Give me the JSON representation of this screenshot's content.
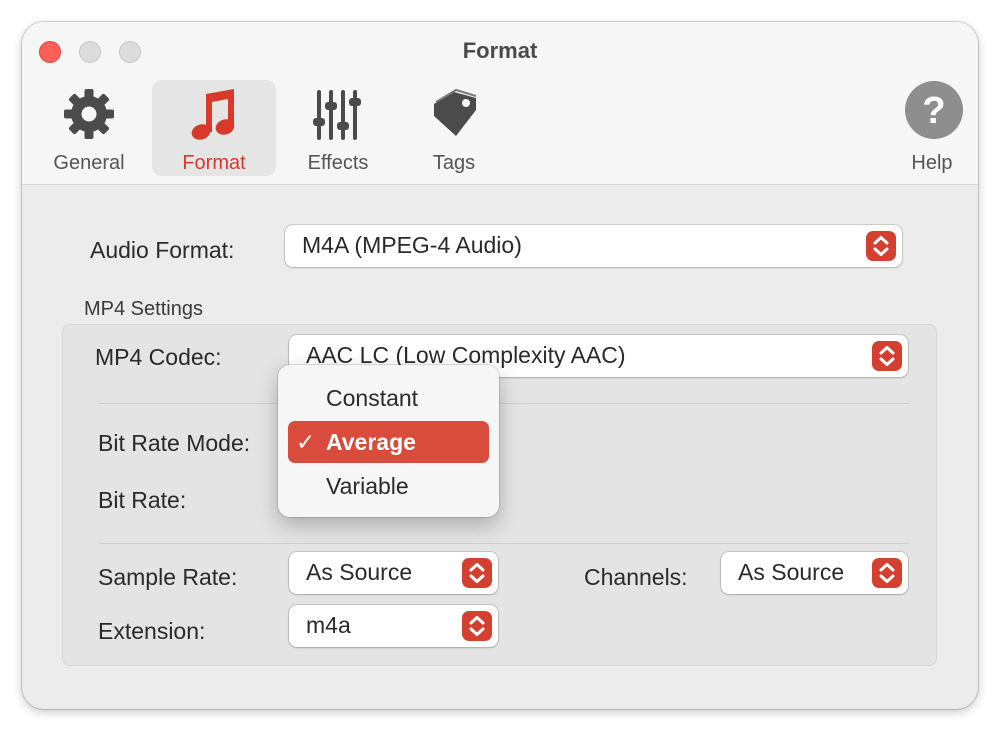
{
  "window": {
    "title": "Format"
  },
  "toolbar": {
    "general": {
      "label": "General",
      "icon": "gear-icon"
    },
    "format": {
      "label": "Format",
      "icon": "music-note-icon"
    },
    "effects": {
      "label": "Effects",
      "icon": "sliders-icon"
    },
    "tags": {
      "label": "Tags",
      "icon": "tag-icon"
    },
    "help": {
      "label": "Help",
      "icon": "question-icon"
    },
    "selected": "format"
  },
  "form": {
    "audio_format": {
      "label": "Audio Format:",
      "value": "M4A (MPEG-4 Audio)"
    },
    "mp4_settings": {
      "title": "MP4 Settings",
      "codec": {
        "label": "MP4 Codec:",
        "value": "AAC LC (Low Complexity AAC)"
      },
      "bit_rate_mode": {
        "label": "Bit Rate Mode:"
      },
      "bit_rate": {
        "label": "Bit Rate:"
      },
      "sample_rate": {
        "label": "Sample Rate:",
        "value": "As Source"
      },
      "channels": {
        "label": "Channels:",
        "value": "As Source"
      },
      "extension": {
        "label": "Extension:",
        "value": "m4a"
      }
    }
  },
  "bit_rate_menu": {
    "items": [
      {
        "label": "Constant"
      },
      {
        "label": "Average",
        "checked": true,
        "check_mark": "✓"
      },
      {
        "label": "Variable"
      }
    ]
  },
  "colors": {
    "accent": "#d94b3a",
    "stepper": "#d4402f",
    "close_button": "#fe5f57"
  }
}
